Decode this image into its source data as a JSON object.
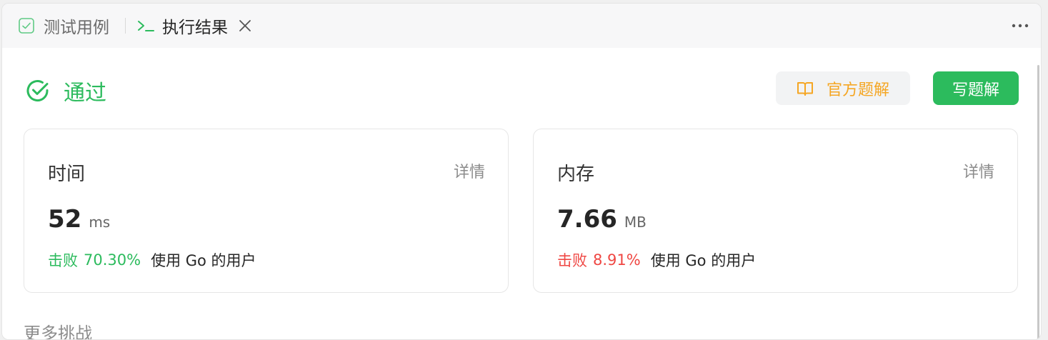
{
  "tabs": {
    "testcase_label": "测试用例",
    "result_label": "执行结果"
  },
  "status": {
    "label": "通过",
    "color": "#2cbb5d"
  },
  "buttons": {
    "official_solution": "官方题解",
    "write_solution": "写题解"
  },
  "time_card": {
    "title": "时间",
    "detail": "详情",
    "value": "52",
    "unit": "ms",
    "beat_word": "击败",
    "beat_percent": "70.30%",
    "beat_suffix": "使用 Go 的用户"
  },
  "memory_card": {
    "title": "内存",
    "detail": "详情",
    "value": "7.66",
    "unit": "MB",
    "beat_word": "击败",
    "beat_percent": "8.91%",
    "beat_suffix": "使用 Go 的用户"
  },
  "more_challenges": "更多挑战",
  "icons": {
    "testcase": "checkbox-icon",
    "result": "terminal-icon",
    "close": "close-icon",
    "more": "more-horizontal-icon",
    "status": "check-circle-icon",
    "book": "book-icon"
  },
  "colors": {
    "accent_green": "#2cbb5d",
    "accent_orange": "#f5a623",
    "danger_red": "#ef4743"
  }
}
